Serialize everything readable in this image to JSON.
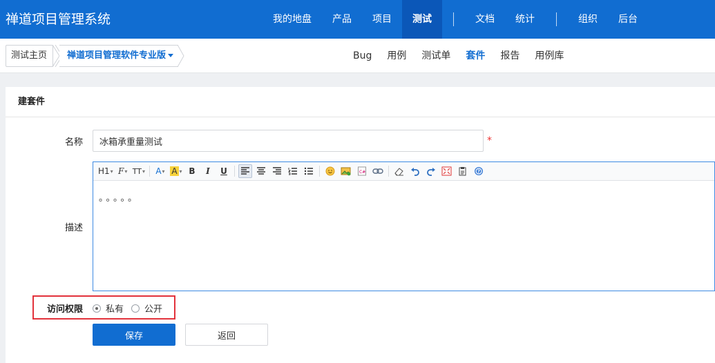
{
  "app": {
    "title": "禅道项目管理系统"
  },
  "nav": {
    "items": [
      {
        "label": "我的地盘"
      },
      {
        "label": "产品"
      },
      {
        "label": "项目"
      },
      {
        "label": "测试",
        "active": true
      },
      {
        "label": "文档"
      },
      {
        "label": "统计"
      },
      {
        "label": "组织"
      },
      {
        "label": "后台"
      }
    ]
  },
  "breadcrumb": {
    "home": "测试主页",
    "product": "禅道项目管理软件专业版"
  },
  "subnav": {
    "items": [
      {
        "label": "Bug"
      },
      {
        "label": "用例"
      },
      {
        "label": "测试单"
      },
      {
        "label": "套件",
        "active": true
      },
      {
        "label": "报告"
      },
      {
        "label": "用例库"
      }
    ]
  },
  "form": {
    "title": "建套件",
    "name_label": "名称",
    "name_value": "冰箱承重量测试",
    "required_mark": "*",
    "desc_label": "描述",
    "desc_value": "。。。。。",
    "acl_label": "访问权限",
    "acl_options": [
      {
        "label": "私有",
        "checked": true
      },
      {
        "label": "公开",
        "checked": false
      }
    ],
    "save_label": "保存",
    "back_label": "返回"
  },
  "editor_toolbar": {
    "heading": "H1",
    "font_family": "F",
    "font_size": "TT",
    "font_color": "A",
    "bg_color": "A",
    "bold": "B",
    "italic": "I",
    "underline": "U"
  },
  "colors": {
    "brand": "#116dd1",
    "nav_active": "#0b57b8",
    "highlight_box": "#e2323b",
    "required": "#e33333"
  }
}
